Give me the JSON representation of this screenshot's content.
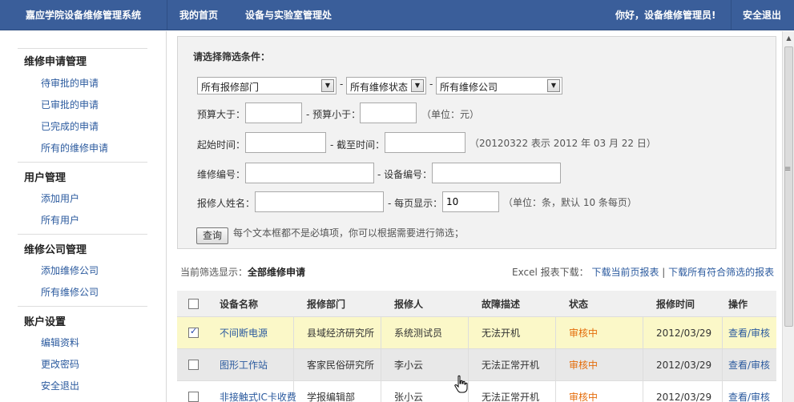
{
  "header": {
    "brand": "嘉应学院设备维修管理系统",
    "nav": [
      "我的首页",
      "设备与实验室管理处"
    ],
    "greeting": "你好，设备维修管理员!",
    "logout": "安全退出"
  },
  "sidebar": {
    "groups": [
      {
        "title": "维修申请管理",
        "items": [
          "待审批的申请",
          "已审批的申请",
          "已完成的申请",
          "所有的维修申请"
        ]
      },
      {
        "title": "用户管理",
        "items": [
          "添加用户",
          "所有用户"
        ]
      },
      {
        "title": "维修公司管理",
        "items": [
          "添加维修公司",
          "所有维修公司"
        ]
      },
      {
        "title": "账户设置",
        "items": [
          "编辑资料",
          "更改密码",
          "安全退出"
        ]
      }
    ]
  },
  "filter": {
    "title": "请选择筛选条件：",
    "dept_select": "所有报修部门",
    "status_select": "所有维修状态",
    "company_select": "所有维修公司",
    "dash": "-",
    "budget_gt": "预算大于：",
    "budget_lt": "- 预算小于：",
    "budget_unit": "（单位：元）",
    "start_time": "起始时间：",
    "end_time": "- 截至时间：",
    "time_hint": "（20120322 表示 2012 年 03 月 22 日）",
    "repair_no": "维修编号：",
    "device_no": "- 设备编号：",
    "reporter": "报修人姓名：",
    "page_size_label": "- 每页显示：",
    "page_size_value": "10",
    "page_size_hint": "（单位：条，默认 10 条每页）",
    "query_button": "查询",
    "query_hint": "每个文本框都不是必填项，你可以根据需要进行筛选；"
  },
  "summary": {
    "current_label": "当前筛选显示：",
    "current_value": "全部维修申请",
    "excel_label": "Excel 报表下载：",
    "download_page": "下载当前页报表",
    "divider": "|",
    "download_all": "下载所有符合筛选的报表"
  },
  "table": {
    "headers": [
      "设备名称",
      "报修部门",
      "报修人",
      "故障描述",
      "状态",
      "报修时间",
      "操作"
    ],
    "rows": [
      {
        "checked": true,
        "name": "不间断电源",
        "dept": "县域经济研究所",
        "reporter": "系统测试员",
        "fault": "无法开机",
        "status": "审核中",
        "time": "2012/03/29",
        "action": "查看/审核"
      },
      {
        "checked": false,
        "name": "图形工作站",
        "dept": "客家民俗研究所",
        "reporter": "李小云",
        "fault": "无法正常开机",
        "status": "审核中",
        "time": "2012/03/29",
        "action": "查看/审核"
      },
      {
        "checked": false,
        "name": "非接触式IC卡收费",
        "dept": "学报编辑部",
        "reporter": "张小云",
        "fault": "无法正常开机",
        "status": "审核中",
        "time": "2012/03/29",
        "action": "查看/审核"
      }
    ]
  },
  "colors": {
    "topbar": "#3a5e9a",
    "link": "#2b5a9e",
    "status": "#e46c0a",
    "selected_row": "#fbf8c8",
    "hover_row": "#e8e8e8"
  }
}
